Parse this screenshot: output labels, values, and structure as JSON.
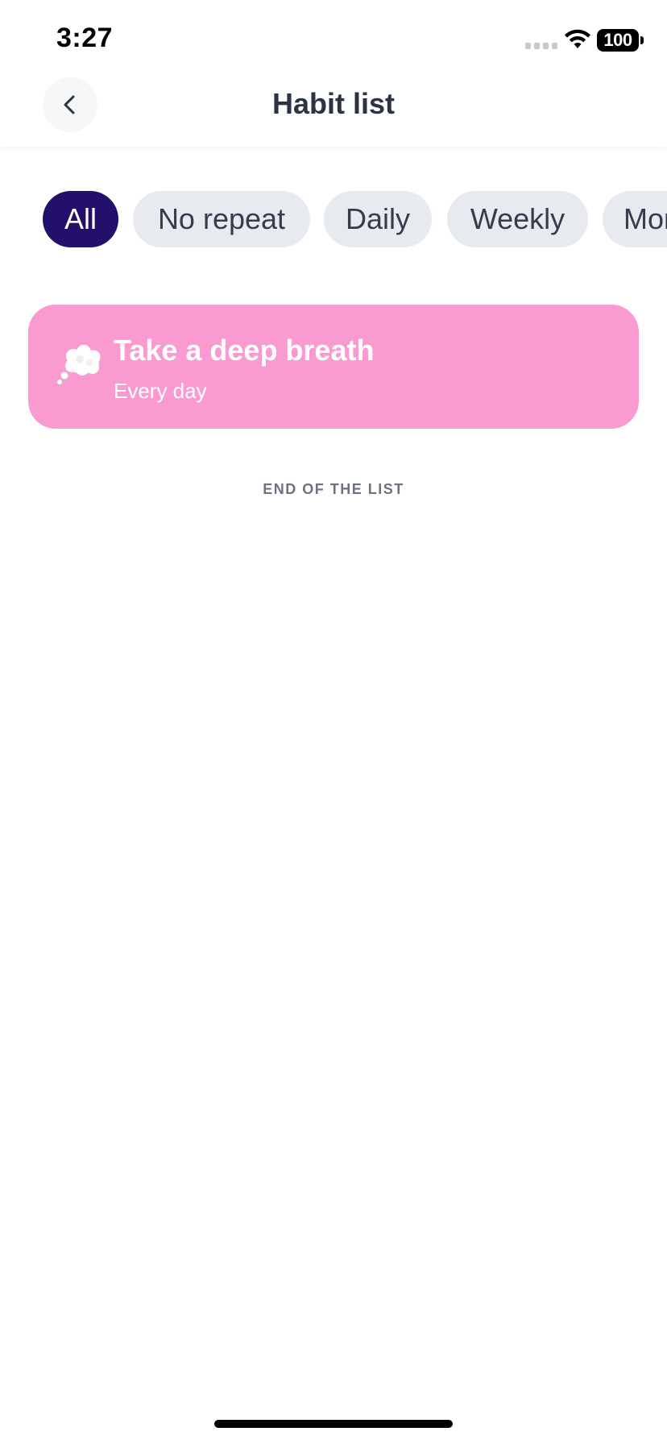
{
  "status_bar": {
    "time": "3:27",
    "battery": "100"
  },
  "header": {
    "title": "Habit list",
    "back_icon": "chevron-left-icon"
  },
  "filters": {
    "chips": [
      {
        "label": "All",
        "active": true
      },
      {
        "label": "No repeat",
        "active": false
      },
      {
        "label": "Daily",
        "active": false
      },
      {
        "label": "Weekly",
        "active": false
      },
      {
        "label": "Monthly",
        "active": false
      }
    ],
    "active_color": "#22106a",
    "inactive_color": "#e7eaef"
  },
  "habits": [
    {
      "icon": "thought-bubble-icon",
      "title": "Take a deep breath",
      "subtitle": "Every day",
      "color": "#f99bd0"
    }
  ],
  "footer_note": "END OF THE LIST"
}
